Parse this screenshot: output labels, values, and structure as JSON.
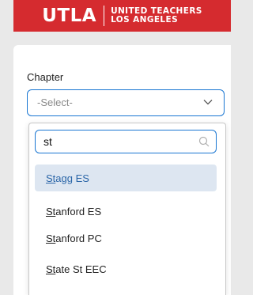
{
  "brand": {
    "name": "UTLA",
    "subtitle_line1": "UNITED TEACHERS",
    "subtitle_line2": "LOS ANGELES",
    "color": "#d52b2f"
  },
  "form": {
    "chapter_label": "Chapter",
    "select_value": "-Select-"
  },
  "dropdown": {
    "search_value": "st",
    "options": [
      {
        "match": "St",
        "rest": "agg ES",
        "highlighted": true
      },
      {
        "match": "St",
        "rest": "anford ES",
        "highlighted": false
      },
      {
        "match": "St",
        "rest": "anford PC",
        "highlighted": false
      },
      {
        "match": "St",
        "rest": "ate St EEC",
        "highlighted": false
      }
    ]
  },
  "colors": {
    "accent": "#1976d2",
    "highlight_bg": "#dde6f1",
    "highlight_text": "#2b66a8"
  }
}
